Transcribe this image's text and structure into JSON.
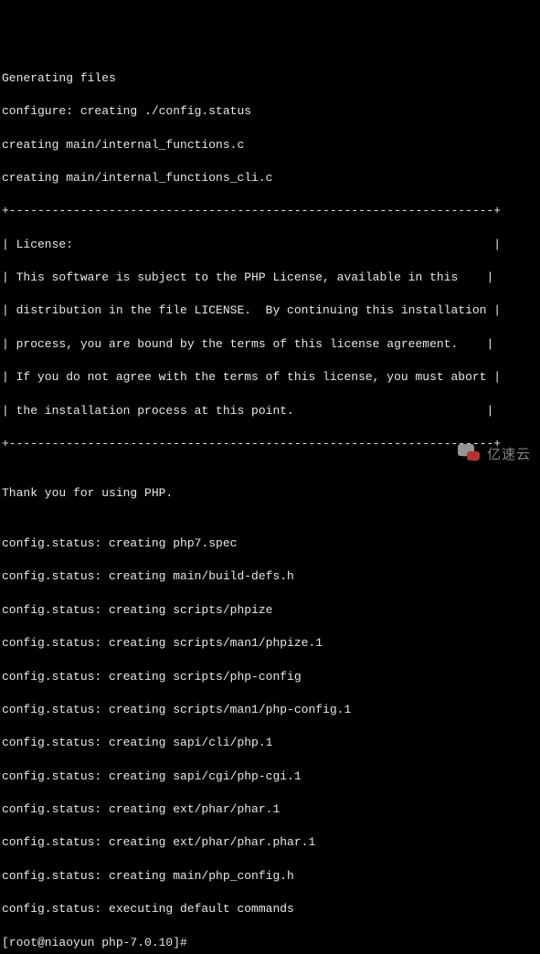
{
  "lines": {
    "l0": "Generating files",
    "l1": "configure: creating ./config.status",
    "l2": "creating main/internal_functions.c",
    "l3": "creating main/internal_functions_cli.c",
    "l4": "+--------------------------------------------------------------------+",
    "l5": "| License:                                                           |",
    "l6": "| This software is subject to the PHP License, available in this    |",
    "l7": "| distribution in the file LICENSE.  By continuing this installation |",
    "l8": "| process, you are bound by the terms of this license agreement.    |",
    "l9": "| If you do not agree with the terms of this license, you must abort |",
    "l10": "| the installation process at this point.                           |",
    "l11": "+--------------------------------------------------------------------+",
    "l12": "",
    "l13": "Thank you for using PHP.",
    "l14": "",
    "l15": "config.status: creating php7.spec",
    "l16": "config.status: creating main/build-defs.h",
    "l17": "config.status: creating scripts/phpize",
    "l18": "config.status: creating scripts/man1/phpize.1",
    "l19": "config.status: creating scripts/php-config",
    "l20": "config.status: creating scripts/man1/php-config.1",
    "l21": "config.status: creating sapi/cli/php.1",
    "l22": "config.status: creating sapi/cgi/php-cgi.1",
    "l23": "config.status: creating ext/phar/phar.1",
    "l24": "config.status: creating ext/phar/phar.phar.1",
    "l25": "config.status: creating main/php_config.h",
    "l26": "config.status: executing default commands"
  },
  "prompt": {
    "text": "[root@niaoyun php-7.0.10]#"
  },
  "watermark": {
    "text": "亿速云"
  }
}
